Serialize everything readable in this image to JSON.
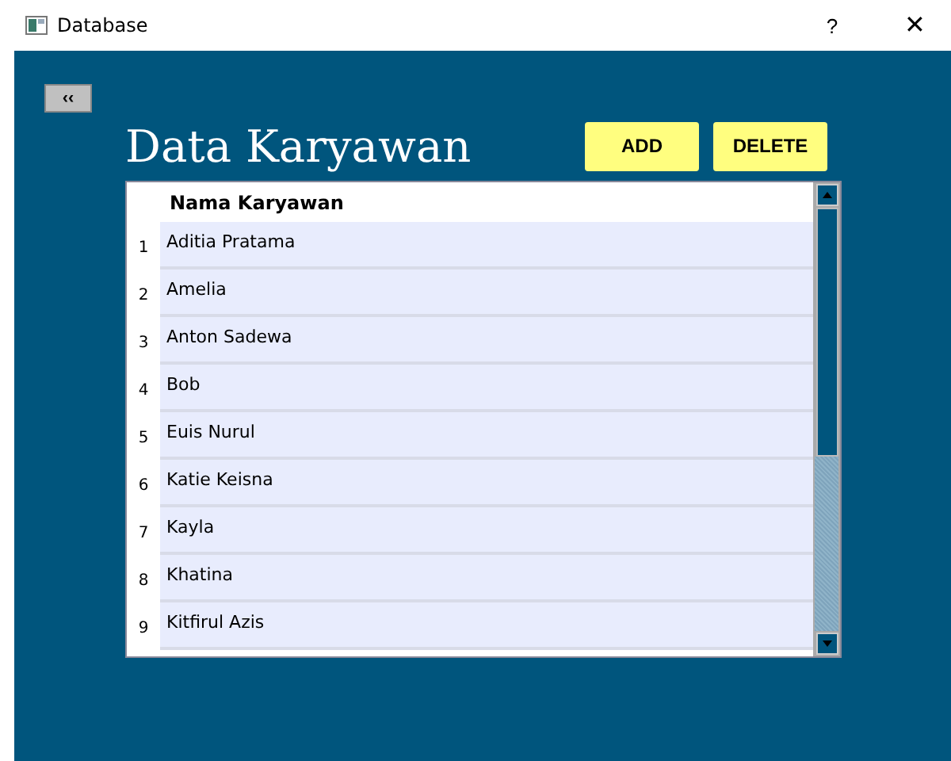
{
  "window": {
    "title": "Database",
    "help": "?",
    "close": "✕"
  },
  "back_button": "‹‹",
  "heading": "Data Karyawan",
  "buttons": [
    "ADD",
    "DELETE"
  ],
  "table": {
    "columns": [
      "Nama Karyawan"
    ],
    "rows": [
      {
        "number": "1",
        "name": "Aditia Pratama"
      },
      {
        "number": "2",
        "name": "Amelia"
      },
      {
        "number": "3",
        "name": "Anton Sadewa"
      },
      {
        "number": "4",
        "name": "Bob"
      },
      {
        "number": "5",
        "name": "Euis Nurul"
      },
      {
        "number": "6",
        "name": "Katie Keisna"
      },
      {
        "number": "7",
        "name": "Kayla"
      },
      {
        "number": "8",
        "name": "Khatina"
      },
      {
        "number": "9",
        "name": "Kitfirul Azis"
      }
    ]
  }
}
